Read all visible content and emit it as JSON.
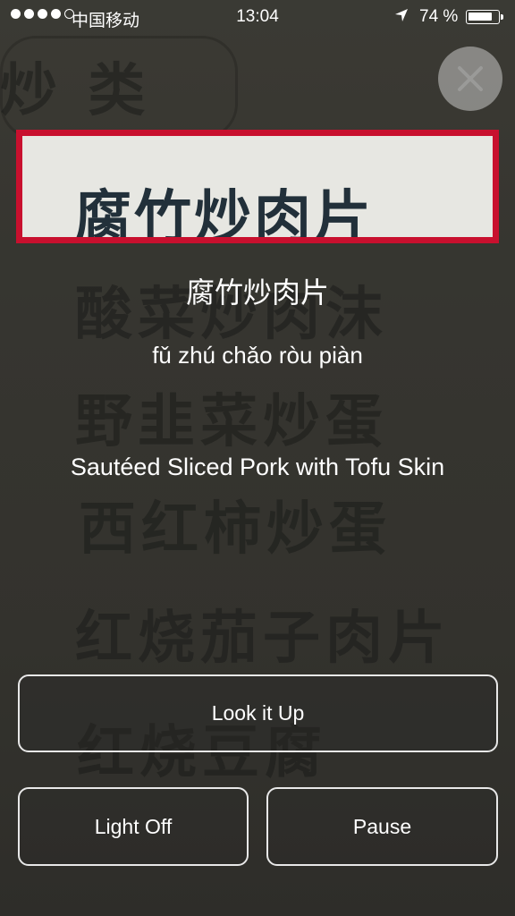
{
  "status_bar": {
    "carrier": "中国移动",
    "time": "13:04",
    "battery": "74 %"
  },
  "camera_background": {
    "menu_lines": [
      "炒 类",
      "酸菜炒肉沫",
      "野韭菜炒蛋",
      "西红柿炒蛋",
      "红烧茄子肉片",
      "红烧豆腐"
    ]
  },
  "scan": {
    "captured_text": "腐竹炒肉片"
  },
  "result": {
    "hanzi": "腐竹炒肉片",
    "pinyin": "fǔ zhú chǎo ròu piàn",
    "english": "Sautéed Sliced Pork with Tofu Skin"
  },
  "buttons": {
    "look_it_up": "Look it Up",
    "light_off": "Light Off",
    "pause": "Pause"
  },
  "icons": [
    "close-icon",
    "location-arrow-icon",
    "battery-icon",
    "signal-icon"
  ],
  "colors": {
    "scan_frame": "#c8102e"
  }
}
